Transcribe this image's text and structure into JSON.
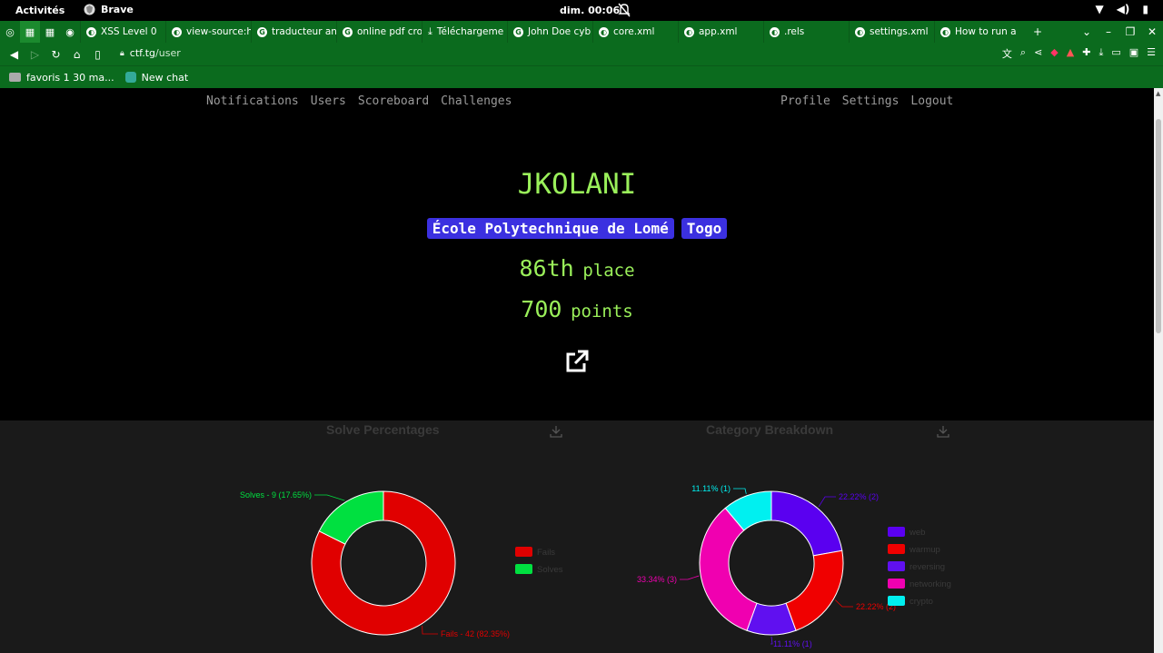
{
  "system": {
    "activities": "Activités",
    "app": "Brave",
    "clock": "dim. 00:06"
  },
  "tabs": [
    {
      "label": "XSS Level 0",
      "icon": "globe-icon"
    },
    {
      "label": "view-source:h",
      "icon": "globe-icon"
    },
    {
      "label": "traducteur an",
      "icon": "google-icon"
    },
    {
      "label": "online pdf cro",
      "icon": "google-icon"
    },
    {
      "label": "Téléchargeme",
      "icon": "download-icon"
    },
    {
      "label": "John Doe cyb",
      "icon": "google-icon"
    },
    {
      "label": "core.xml",
      "icon": "globe-icon"
    },
    {
      "label": "app.xml",
      "icon": "globe-icon"
    },
    {
      "label": ".rels",
      "icon": "globe-icon"
    },
    {
      "label": "settings.xml",
      "icon": "globe-icon"
    },
    {
      "label": "How to run a",
      "icon": "globe-icon"
    }
  ],
  "address": {
    "host": "ctf.tg",
    "path": "/user"
  },
  "bookmarks": [
    {
      "label": "favoris 1 30 ma...",
      "icon": "folder-icon"
    },
    {
      "label": "New chat",
      "icon": "chatgpt-icon"
    }
  ],
  "nav": {
    "left": [
      "Notifications",
      "Users",
      "Scoreboard",
      "Challenges"
    ],
    "right": [
      "Profile",
      "Settings",
      "Logout"
    ]
  },
  "profile": {
    "username": "JKOLANI",
    "affiliation": "École Polytechnique de Lomé",
    "country": "Togo",
    "place_num": "86th",
    "place_label": "place",
    "points_num": "700",
    "points_label": "points"
  },
  "charts": {
    "solve_title": "Solve Percentages",
    "category_title": "Category Breakdown"
  },
  "chart_data": [
    {
      "type": "pie",
      "title": "Solve Percentages",
      "categories": [
        "Fails",
        "Solves"
      ],
      "values": [
        42,
        9
      ],
      "percent": [
        82.35,
        17.65
      ],
      "labels": [
        "Fails - 42 (82.35%)",
        "Solves - 9 (17.65%)"
      ],
      "colors": [
        "#e00000",
        "#00e040"
      ],
      "legend": "right"
    },
    {
      "type": "pie",
      "title": "Category Breakdown",
      "categories": [
        "web",
        "warmup",
        "reversing",
        "networking",
        "crypto"
      ],
      "values": [
        2,
        2,
        1,
        3,
        1
      ],
      "percent": [
        22.22,
        22.22,
        11.11,
        33.34,
        11.11
      ],
      "labels": [
        "22.22% (2)",
        "22.22% (2)",
        "11.11% (1)",
        "33.34% (3)",
        "11.11% (1)"
      ],
      "colors": [
        "#5a00f0",
        "#f00000",
        "#6010f0",
        "#f000b0",
        "#00f0f0"
      ],
      "legend": "right"
    }
  ]
}
